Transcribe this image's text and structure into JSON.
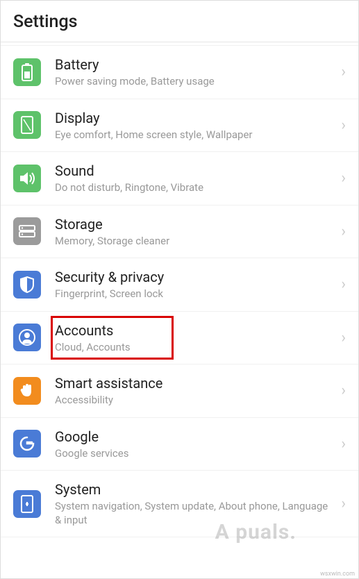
{
  "header": {
    "title": "Settings"
  },
  "items": [
    {
      "icon": "battery-icon",
      "icon_bg": "ic-green",
      "title": "Battery",
      "subtitle": "Power saving mode, Battery usage"
    },
    {
      "icon": "display-icon",
      "icon_bg": "ic-green2",
      "title": "Display",
      "subtitle": "Eye comfort, Home screen style, Wallpaper"
    },
    {
      "icon": "sound-icon",
      "icon_bg": "ic-green3",
      "title": "Sound",
      "subtitle": "Do not disturb, Ringtone, Vibrate"
    },
    {
      "icon": "storage-icon",
      "icon_bg": "ic-gray",
      "title": "Storage",
      "subtitle": "Memory, Storage cleaner"
    },
    {
      "icon": "security-icon",
      "icon_bg": "ic-blue",
      "title": "Security & privacy",
      "subtitle": "Fingerprint, Screen lock"
    },
    {
      "icon": "accounts-icon",
      "icon_bg": "ic-blue2",
      "title": "Accounts",
      "subtitle": "Cloud, Accounts",
      "highlighted": true
    },
    {
      "icon": "assist-icon",
      "icon_bg": "ic-orange",
      "title": "Smart assistance",
      "subtitle": "Accessibility"
    },
    {
      "icon": "google-icon",
      "icon_bg": "ic-blue3",
      "title": "Google",
      "subtitle": "Google services"
    },
    {
      "icon": "system-icon",
      "icon_bg": "ic-blue4",
      "title": "System",
      "subtitle": "System navigation, System update, About phone, Language & input"
    }
  ],
  "watermark": "A puals.",
  "watermark_domain": "wsxwin.com"
}
